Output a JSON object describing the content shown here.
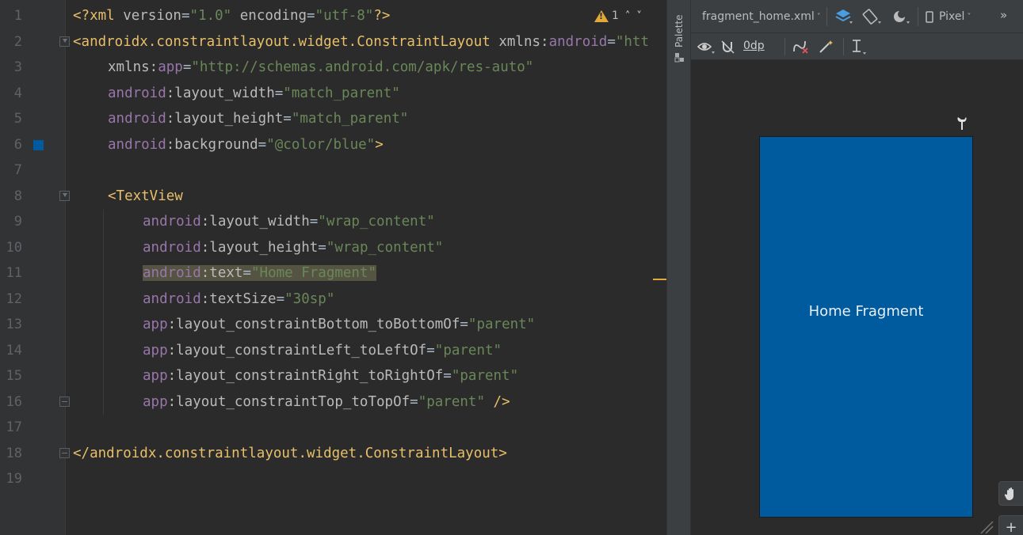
{
  "editor": {
    "line_numbers": [
      "1",
      "2",
      "3",
      "4",
      "5",
      "6",
      "7",
      "8",
      "9",
      "10",
      "11",
      "12",
      "13",
      "14",
      "15",
      "16",
      "17",
      "18",
      "19"
    ],
    "lines": {
      "l1": {
        "a": "<?xml ",
        "b": "version",
        "c": "=",
        "d": "\"1.0\"",
        "e": " encoding",
        "f": "=",
        "g": "\"utf-8\"",
        "h": "?>"
      },
      "l2": {
        "a": "<androidx.constraintlayout.widget.ConstraintLayout ",
        "b": "xmlns:",
        "c": "android",
        "d": "=",
        "e": "\"htt"
      },
      "l3": {
        "a": "xmlns:",
        "b": "app",
        "c": "=",
        "d": "\"http://schemas.android.com/apk/res-auto\""
      },
      "l4": {
        "a": "android",
        "b": ":layout_width",
        "c": "=",
        "d": "\"match_parent\""
      },
      "l5": {
        "a": "android",
        "b": ":layout_height",
        "c": "=",
        "d": "\"match_parent\""
      },
      "l6": {
        "a": "android",
        "b": ":background",
        "c": "=",
        "d": "\"@color/blue\"",
        "e": ">"
      },
      "l8": {
        "a": "<TextView"
      },
      "l9": {
        "a": "android",
        "b": ":layout_width",
        "c": "=",
        "d": "\"wrap_content\""
      },
      "l10": {
        "a": "android",
        "b": ":layout_height",
        "c": "=",
        "d": "\"wrap_content\""
      },
      "l11": {
        "a": "android",
        "b": ":text",
        "c": "=",
        "d": "\"Home Fragment\""
      },
      "l12": {
        "a": "android",
        "b": ":textSize",
        "c": "=",
        "d": "\"30sp\""
      },
      "l13": {
        "a": "app",
        "b": ":layout_constraintBottom_toBottomOf",
        "c": "=",
        "d": "\"parent\""
      },
      "l14": {
        "a": "app",
        "b": ":layout_constraintLeft_toLeftOf",
        "c": "=",
        "d": "\"parent\""
      },
      "l15": {
        "a": "app",
        "b": ":layout_constraintRight_toRightOf",
        "c": "=",
        "d": "\"parent\""
      },
      "l16": {
        "a": "app",
        "b": ":layout_constraintTop_toTopOf",
        "c": "=",
        "d": "\"parent\"",
        "e": " />"
      },
      "l18": {
        "a": "</androidx.constraintlayout.widget.ConstraintLayout>"
      }
    },
    "warning_count": "1",
    "background_swatch_color": "#005a9e"
  },
  "palette": {
    "label": "Palette"
  },
  "design": {
    "file_selector": "fragment_home.xml",
    "device_selector": "Pixel",
    "overflow": "»",
    "default_margin": "0dp",
    "preview_text": "Home Fragment",
    "preview_background": "#005a9e"
  },
  "colors": {
    "tag": "#e8bf6a",
    "namespace": "#9876aa",
    "attribute": "#bababa",
    "value": "#6a8759",
    "warning": "#e0a93a"
  }
}
